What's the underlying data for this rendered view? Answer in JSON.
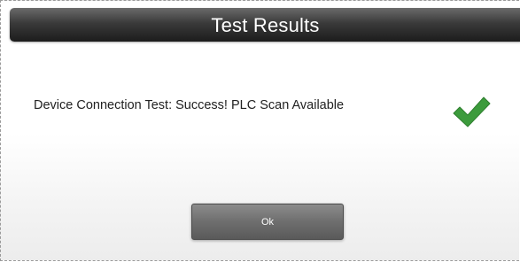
{
  "dialog": {
    "title": "Test Results",
    "message": "Device Connection Test: Success! PLC Scan Available",
    "status_icon": "check-icon",
    "status_color": "#3c9b3c",
    "ok_label": "Ok"
  }
}
